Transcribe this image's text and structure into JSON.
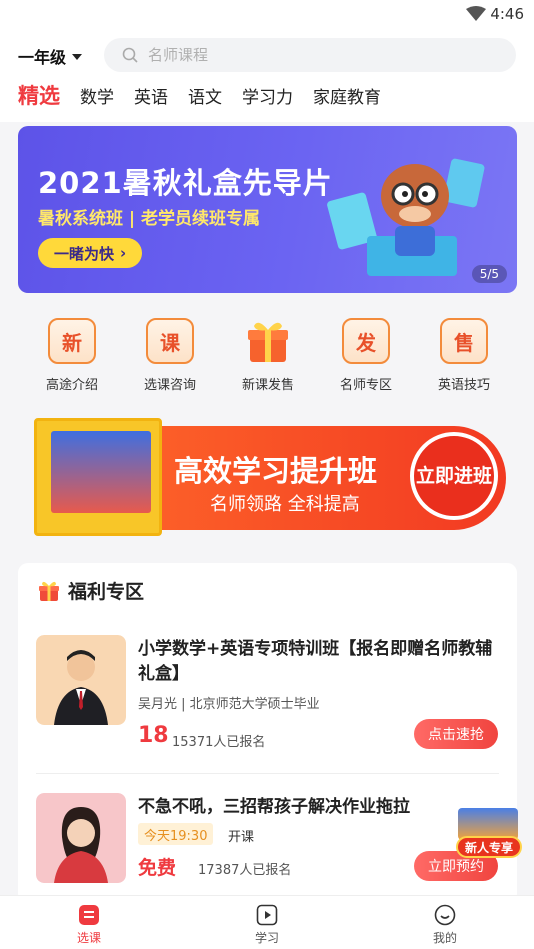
{
  "status_bar": {
    "time": "4:46"
  },
  "header": {
    "grade": "一年级",
    "search_placeholder": "名师课程",
    "tabs": [
      "精选",
      "数学",
      "英语",
      "语文",
      "学习力",
      "家庭教育"
    ]
  },
  "banner": {
    "title": "2021暑秋礼盒先导片",
    "subtitle": "暑秋系统班 | 老学员续班专属",
    "cta": "一睹为快",
    "pager": "5/5"
  },
  "categories": [
    {
      "icon_char": "新",
      "label": "高途介绍"
    },
    {
      "icon_char": "课",
      "label": "选课咨询"
    },
    {
      "icon_char": "",
      "label": "新课发售"
    },
    {
      "icon_char": "发",
      "label": "名师专区"
    },
    {
      "icon_char": "售",
      "label": "英语技巧"
    }
  ],
  "promo": {
    "title": "高效学习提升班",
    "subtitle": "名师领路 全科提高",
    "button": "立即进班"
  },
  "welfare": {
    "title": "福利专区",
    "courses": [
      {
        "title": "小学数学+英语专项特训班【报名即赠名师教辅礼盒】",
        "teacher": "吴月光 | 北京师范大学硕士毕业",
        "price": "18",
        "enrolled": "15371人已报名",
        "button": "点击速抢"
      },
      {
        "title": "不急不吼，三招帮孩子解决作业拖拉",
        "time_tag": "今天19:30",
        "time_suffix": "开课",
        "price": "免费",
        "enrolled": "17387人已报名",
        "button": "立即预约"
      }
    ]
  },
  "floating_badge": "新人专享",
  "bottom_nav": [
    {
      "label": "选课",
      "icon": "course-icon",
      "active": true
    },
    {
      "label": "学习",
      "icon": "play-icon",
      "active": false
    },
    {
      "label": "我的",
      "icon": "profile-icon",
      "active": false
    }
  ],
  "colors": {
    "accent": "#ef3a3f",
    "banner": "#5d53e8",
    "promo": "#f23a22"
  }
}
